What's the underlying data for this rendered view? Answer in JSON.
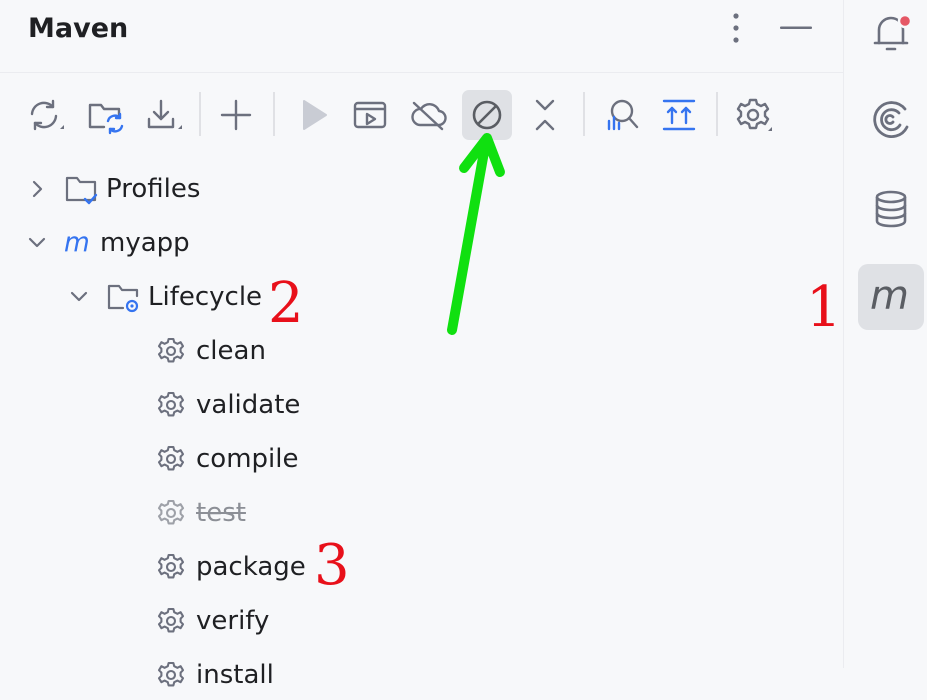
{
  "panel": {
    "title": "Maven",
    "header_icons": [
      "more-vertical-icon",
      "minimize-icon"
    ]
  },
  "toolbar": {
    "buttons": [
      {
        "name": "reload-projects-icon"
      },
      {
        "name": "reload-folders-icon"
      },
      {
        "name": "download-sources-icon"
      },
      {
        "name": "add-maven-project-icon"
      },
      {
        "name": "run-maven-build-icon"
      },
      {
        "name": "execute-goal-icon"
      },
      {
        "name": "offline-mode-icon"
      },
      {
        "name": "skip-tests-icon",
        "active": true
      },
      {
        "name": "collapse-all-icon"
      },
      {
        "name": "analyze-dependencies-icon"
      },
      {
        "name": "show-diagram-icon"
      },
      {
        "name": "settings-icon"
      }
    ]
  },
  "tree": {
    "profiles_label": "Profiles",
    "project_label": "myapp",
    "lifecycle_label": "Lifecycle",
    "goals": [
      {
        "label": "clean",
        "disabled": false
      },
      {
        "label": "validate",
        "disabled": false
      },
      {
        "label": "compile",
        "disabled": false
      },
      {
        "label": "test",
        "disabled": true
      },
      {
        "label": "package",
        "disabled": false
      },
      {
        "label": "verify",
        "disabled": false
      },
      {
        "label": "install",
        "disabled": false
      }
    ]
  },
  "annotations": {
    "one": "1",
    "two": "2",
    "three": "3"
  },
  "sidebar": {
    "items": [
      {
        "name": "notifications-icon",
        "badge": true
      },
      {
        "name": "ai-assistant-icon"
      },
      {
        "name": "database-icon"
      },
      {
        "name": "maven-icon",
        "active": true
      }
    ]
  },
  "colors": {
    "accent_blue": "#3574f0",
    "annotation_red": "#e8101a",
    "arrow_green": "#10e010",
    "active_bg": "#dfe1e5",
    "badge_red": "#e55765"
  }
}
